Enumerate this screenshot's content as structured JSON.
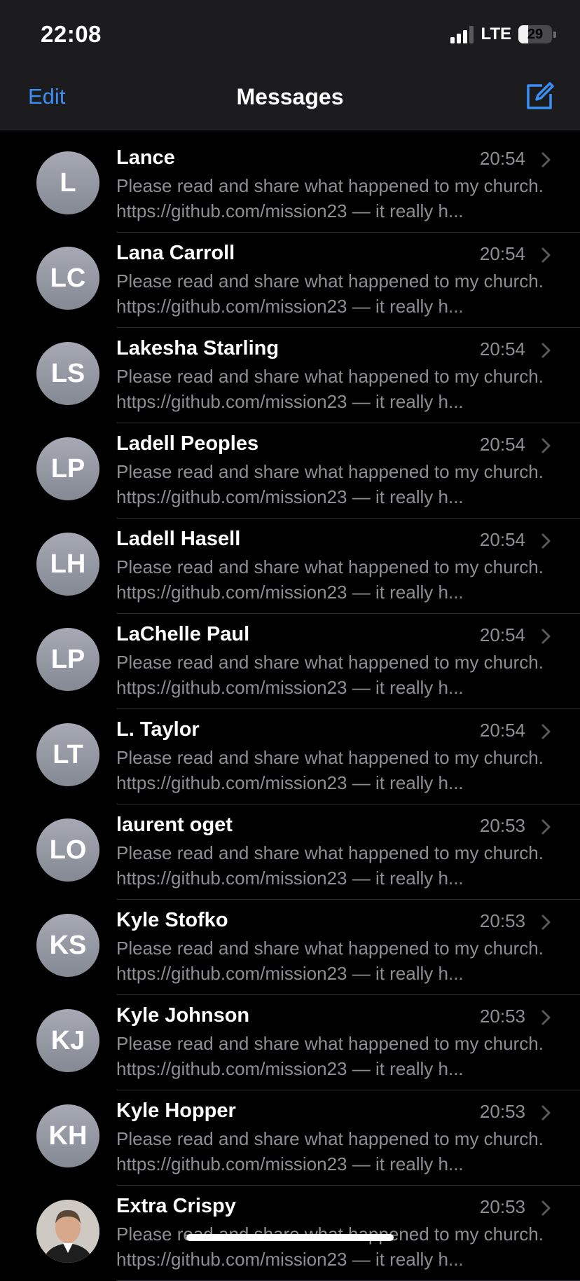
{
  "status_bar": {
    "time": "22:08",
    "network": "LTE",
    "battery": "29",
    "battery_level": 0.29
  },
  "nav": {
    "edit_label": "Edit",
    "title": "Messages",
    "compose_icon": "compose-icon"
  },
  "colors": {
    "accent": "#3a8ff5",
    "background": "#000000",
    "header": "#1c1c1e",
    "secondary_text": "#8e8e93",
    "separator": "#2c2c2e"
  },
  "conversations": [
    {
      "initials": "L",
      "name": "Lance",
      "time": "20:54",
      "preview": "Please read and share what happened to my church. https://github.com/mission23 — it really h..."
    },
    {
      "initials": "LC",
      "name": "Lana Carroll",
      "time": "20:54",
      "preview": "Please read and share what happened to my church. https://github.com/mission23 — it really h..."
    },
    {
      "initials": "LS",
      "name": "Lakesha Starling",
      "time": "20:54",
      "preview": "Please read and share what happened to my church. https://github.com/mission23 — it really h..."
    },
    {
      "initials": "LP",
      "name": "Ladell Peoples",
      "time": "20:54",
      "preview": "Please read and share what happened to my church. https://github.com/mission23 — it really h..."
    },
    {
      "initials": "LH",
      "name": "Ladell Hasell",
      "time": "20:54",
      "preview": "Please read and share what happened to my church. https://github.com/mission23 — it really h..."
    },
    {
      "initials": "LP",
      "name": "LaChelle Paul",
      "time": "20:54",
      "preview": "Please read and share what happened to my church. https://github.com/mission23 — it really h..."
    },
    {
      "initials": "LT",
      "name": "L. Taylor",
      "time": "20:54",
      "preview": "Please read and share what happened to my church. https://github.com/mission23 — it really h..."
    },
    {
      "initials": "LO",
      "name": "laurent oget",
      "time": "20:53",
      "preview": "Please read and share what happened to my church. https://github.com/mission23 — it really h..."
    },
    {
      "initials": "KS",
      "name": "Kyle Stofko",
      "time": "20:53",
      "preview": "Please read and share what happened to my church. https://github.com/mission23 — it really h..."
    },
    {
      "initials": "KJ",
      "name": "Kyle Johnson",
      "time": "20:53",
      "preview": "Please read and share what happened to my church. https://github.com/mission23 — it really h..."
    },
    {
      "initials": "KH",
      "name": "Kyle Hopper",
      "time": "20:53",
      "preview": "Please read and share what happened to my church. https://github.com/mission23 — it really h..."
    },
    {
      "initials": "",
      "avatar_icon": "contact-photo",
      "name": "Extra Crispy",
      "time": "20:53",
      "preview": "Please read and share what happened to my church. https://github.com/mission23 — it really h..."
    }
  ]
}
